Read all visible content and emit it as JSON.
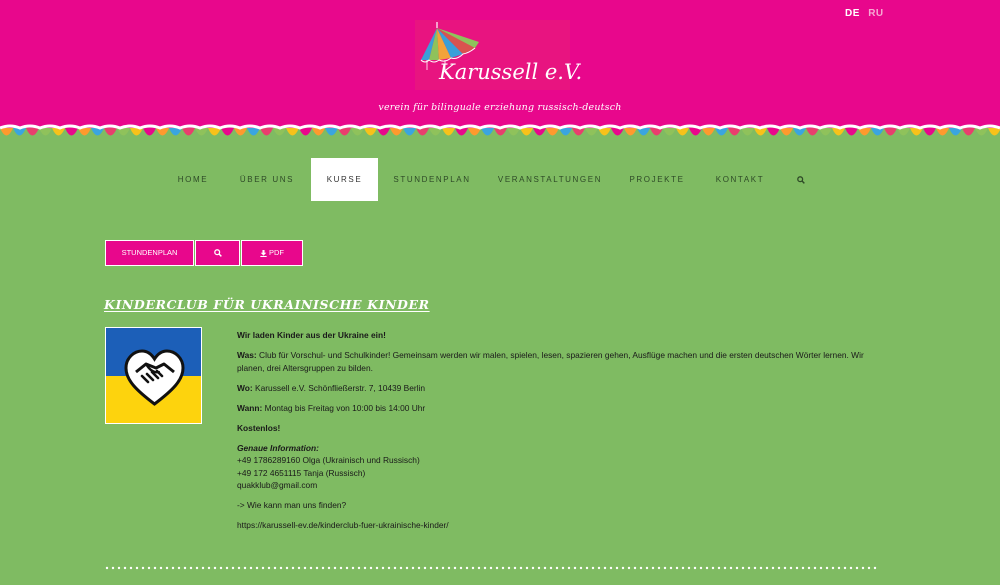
{
  "header": {
    "languages": [
      {
        "label": "DE",
        "active": true
      },
      {
        "label": "RU",
        "active": false
      }
    ],
    "logo_text": "Karussell e.V.",
    "tagline": "verein für bilinguale erziehung russisch-deutsch",
    "colors": {
      "header_bg": "#e8078c",
      "page_bg": "#7fbb62"
    }
  },
  "nav": {
    "items": [
      {
        "label": "HOME"
      },
      {
        "label": "ÜBER UNS"
      },
      {
        "label": "KURSE",
        "active": true
      },
      {
        "label": "STUNDENPLAN"
      },
      {
        "label": "VERANSTALTUNGEN"
      },
      {
        "label": "PROJEKTE"
      },
      {
        "label": "KONTAKT"
      }
    ],
    "search_icon": "search-icon"
  },
  "actions": {
    "stundenplan_label": "STUNDENPLAN",
    "zoom_icon": "zoom-icon",
    "pdf_label": "PDF",
    "pdf_icon": "download-icon"
  },
  "post": {
    "title": "Kinderclub für ukrainische Kinder",
    "intro": "Wir laden Kinder aus der Ukraine ein!",
    "was_label": "Was:",
    "was_text": " Club für Vorschul- und Schulkinder! Gemeinsam werden wir malen, spielen, lesen, spazieren gehen, Ausflüge machen und die ersten deutschen Wörter lernen. Wir planen, drei Altersgruppen zu bilden.",
    "wo_label": "Wo:",
    "wo_text": " Karussell e.V. Schönfließerstr. 7, 10439 Berlin",
    "wann_label": "Wann:",
    "wann_text": " Montag bis Freitag von 10:00 bis 14:00 Uhr",
    "kostenlos": "Kostenlos!",
    "info_label": "Genaue Information:",
    "phone1": "+49 1786289160 Olga (Ukrainisch und Russisch)",
    "phone2": "+49 172 4651115 Tanja (Russisch)",
    "email": "quakklub@gmail.com",
    "find_link": "-> Wie kann man uns finden?",
    "url": "https://karussell-ev.de/kinderclub-fuer-ukrainische-kinder/",
    "image_icon": "ukraine-flag-heart-handshake"
  }
}
